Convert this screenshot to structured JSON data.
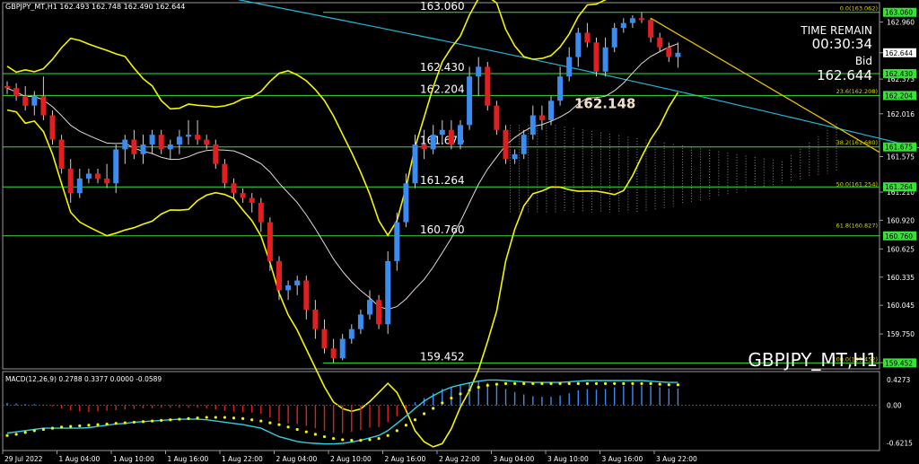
{
  "header": {
    "symbol_info": "GBPJPY_MT,H1  162.493 162.748 162.490 162.644",
    "time_remain_label": "TIME REMAIN",
    "time_remain_value": "00:30:34",
    "bid_label": "Bid",
    "bid_value": "162.644",
    "watermark": "GBPJPY_MT,H1",
    "macd_label": "MACD(12,26,9) 0.2788 0.3377 0.0000 -0.0589"
  },
  "colors": {
    "background": "#000000",
    "bull_candle": "#3a8cf0",
    "bear_candle": "#e02020",
    "bollinger": "#f5f500",
    "level_line": "#38e038",
    "macd_hist": "#3a8cf0",
    "macd_signal": "#f5f500",
    "macd_line": "#30d0e0",
    "trendline": "#e8c000",
    "ma_cyan": "#20b8d8"
  },
  "chart_data": {
    "type": "candlestick",
    "title": "GBPJPY_MT,H1",
    "ylim": [
      159.4,
      163.15
    ],
    "x_tick_labels": [
      "29 Jul 2022",
      "1 Aug 04:00",
      "1 Aug 10:00",
      "1 Aug 16:00",
      "1 Aug 22:00",
      "2 Aug 04:00",
      "2 Aug 10:00",
      "2 Aug 16:00",
      "2 Aug 22:00",
      "3 Aug 04:00",
      "3 Aug 10:00",
      "3 Aug 16:00",
      "3 Aug 22:00"
    ],
    "y_tick_labels": [
      "162.960",
      "162.644",
      "162.373",
      "162.016",
      "161.575",
      "161.210",
      "160.920",
      "160.625",
      "160.335",
      "160.045",
      "159.750",
      "159.455"
    ],
    "y_tick_values": [
      162.96,
      162.644,
      162.373,
      162.016,
      161.575,
      161.21,
      160.92,
      160.625,
      160.335,
      160.045,
      159.75,
      159.455
    ],
    "price_tags": [
      {
        "label": "163.060",
        "value": 163.06,
        "color": "#38e038"
      },
      {
        "label": "162.644",
        "value": 162.644,
        "color": "#ffffff"
      },
      {
        "label": "162.430",
        "value": 162.43,
        "color": "#38e038"
      },
      {
        "label": "162.204",
        "value": 162.204,
        "color": "#38e038"
      },
      {
        "label": "161.675",
        "value": 161.675,
        "color": "#38e038"
      },
      {
        "label": "161.264",
        "value": 161.264,
        "color": "#38e038"
      },
      {
        "label": "160.760",
        "value": 160.76,
        "color": "#38e038"
      },
      {
        "label": "159.452",
        "value": 159.452,
        "color": "#38e038"
      }
    ],
    "levels": [
      {
        "label": "163.060",
        "value": 163.06
      },
      {
        "label": "162.430",
        "value": 162.43
      },
      {
        "label": "162.204",
        "value": 162.204
      },
      {
        "label": "161.675",
        "value": 161.675
      },
      {
        "label": "161.264",
        "value": 161.264
      },
      {
        "label": "160.760",
        "value": 160.76
      },
      {
        "label": "159.452",
        "value": 159.452
      }
    ],
    "fib_levels": [
      {
        "label": "0.0(163.062)",
        "value": 163.062
      },
      {
        "label": "23.6(162.208)",
        "value": 162.208
      },
      {
        "label": "38.2(161.680)",
        "value": 161.68
      },
      {
        "label": "50.0(161.254)",
        "value": 161.254
      },
      {
        "label": "61.8(160.827)",
        "value": 160.827
      },
      {
        "label": "100.0(159.452)",
        "value": 159.452
      }
    ],
    "highlight_price": {
      "label": "162.148",
      "value": 162.148
    },
    "candles": [
      [
        162.3,
        162.35,
        162.22,
        162.28
      ],
      [
        162.28,
        162.33,
        162.15,
        162.2
      ],
      [
        162.2,
        162.3,
        162.05,
        162.1
      ],
      [
        162.1,
        162.25,
        162.0,
        162.2
      ],
      [
        162.2,
        162.4,
        161.95,
        162.0
      ],
      [
        162.0,
        162.05,
        161.7,
        161.75
      ],
      [
        161.75,
        161.8,
        161.4,
        161.45
      ],
      [
        161.45,
        161.55,
        161.1,
        161.2
      ],
      [
        161.2,
        161.45,
        161.15,
        161.35
      ],
      [
        161.35,
        161.45,
        161.3,
        161.4
      ],
      [
        161.4,
        161.45,
        161.3,
        161.35
      ],
      [
        161.35,
        161.5,
        161.25,
        161.3
      ],
      [
        161.3,
        161.7,
        161.2,
        161.65
      ],
      [
        161.65,
        161.8,
        161.5,
        161.75
      ],
      [
        161.75,
        161.85,
        161.55,
        161.6
      ],
      [
        161.6,
        161.8,
        161.5,
        161.7
      ],
      [
        161.7,
        161.85,
        161.6,
        161.8
      ],
      [
        161.8,
        161.85,
        161.6,
        161.65
      ],
      [
        161.65,
        161.75,
        161.55,
        161.7
      ],
      [
        161.7,
        161.85,
        161.6,
        161.78
      ],
      [
        161.78,
        161.95,
        161.7,
        161.8
      ],
      [
        161.8,
        161.95,
        161.7,
        161.75
      ],
      [
        161.75,
        161.8,
        161.65,
        161.7
      ],
      [
        161.7,
        161.75,
        161.45,
        161.5
      ],
      [
        161.5,
        161.55,
        161.25,
        161.3
      ],
      [
        161.3,
        161.35,
        161.15,
        161.2
      ],
      [
        161.2,
        161.25,
        161.1,
        161.15
      ],
      [
        161.15,
        161.2,
        161.0,
        161.1
      ],
      [
        161.1,
        161.15,
        160.8,
        160.9
      ],
      [
        160.9,
        160.95,
        160.4,
        160.5
      ],
      [
        160.5,
        160.55,
        160.1,
        160.2
      ],
      [
        160.2,
        160.3,
        160.1,
        160.25
      ],
      [
        160.25,
        160.35,
        160.15,
        160.3
      ],
      [
        160.3,
        160.35,
        159.9,
        160.0
      ],
      [
        160.0,
        160.1,
        159.7,
        159.8
      ],
      [
        159.8,
        159.9,
        159.55,
        159.6
      ],
      [
        159.6,
        159.7,
        159.45,
        159.5
      ],
      [
        159.5,
        159.75,
        159.48,
        159.7
      ],
      [
        159.7,
        159.85,
        159.65,
        159.8
      ],
      [
        159.8,
        160.0,
        159.75,
        159.95
      ],
      [
        159.95,
        160.2,
        159.9,
        160.1
      ],
      [
        160.1,
        160.15,
        159.8,
        159.85
      ],
      [
        159.85,
        160.6,
        159.75,
        160.5
      ],
      [
        160.5,
        161.0,
        160.4,
        160.9
      ],
      [
        160.9,
        161.4,
        160.85,
        161.3
      ],
      [
        161.3,
        161.8,
        161.25,
        161.7
      ],
      [
        161.7,
        161.85,
        161.55,
        161.65
      ],
      [
        161.65,
        161.9,
        161.6,
        161.8
      ],
      [
        161.8,
        161.95,
        161.7,
        161.85
      ],
      [
        161.85,
        161.95,
        161.65,
        161.7
      ],
      [
        161.7,
        161.95,
        161.65,
        161.9
      ],
      [
        161.9,
        162.5,
        161.85,
        162.4
      ],
      [
        162.4,
        162.6,
        162.2,
        162.5
      ],
      [
        162.5,
        162.55,
        162.05,
        162.1
      ],
      [
        162.1,
        162.15,
        161.8,
        161.85
      ],
      [
        161.85,
        161.9,
        161.5,
        161.55
      ],
      [
        161.55,
        161.65,
        161.5,
        161.6
      ],
      [
        161.6,
        161.85,
        161.55,
        161.8
      ],
      [
        161.8,
        162.1,
        161.75,
        162.0
      ],
      [
        162.0,
        162.1,
        161.85,
        161.95
      ],
      [
        161.95,
        162.2,
        161.9,
        162.15
      ],
      [
        162.15,
        162.5,
        162.1,
        162.4
      ],
      [
        162.4,
        162.7,
        162.35,
        162.6
      ],
      [
        162.6,
        162.9,
        162.5,
        162.85
      ],
      [
        162.85,
        162.95,
        162.7,
        162.75
      ],
      [
        162.75,
        162.8,
        162.4,
        162.45
      ],
      [
        162.45,
        162.8,
        162.4,
        162.7
      ],
      [
        162.7,
        162.95,
        162.65,
        162.9
      ],
      [
        162.9,
        163.0,
        162.85,
        162.95
      ],
      [
        162.95,
        163.03,
        162.9,
        163.0
      ],
      [
        163.0,
        163.06,
        162.95,
        162.98
      ],
      [
        162.98,
        163.0,
        162.75,
        162.8
      ],
      [
        162.8,
        162.85,
        162.65,
        162.7
      ],
      [
        162.7,
        162.75,
        162.55,
        162.6
      ],
      [
        162.6,
        162.75,
        162.49,
        162.644
      ]
    ],
    "macd": {
      "ylim": [
        -0.72,
        0.5
      ],
      "tick_labels": [
        "0.4273",
        "0.00",
        "-0.6215"
      ],
      "tick_values": [
        0.4273,
        0.0,
        -0.6215
      ],
      "histogram": [
        0.04,
        0.03,
        0.02,
        0.02,
        0.01,
        -0.02,
        -0.05,
        -0.08,
        -0.1,
        -0.11,
        -0.1,
        -0.09,
        -0.08,
        -0.07,
        -0.06,
        -0.05,
        -0.05,
        -0.04,
        -0.04,
        -0.04,
        -0.04,
        -0.04,
        -0.05,
        -0.07,
        -0.09,
        -0.1,
        -0.11,
        -0.12,
        -0.14,
        -0.2,
        -0.27,
        -0.3,
        -0.31,
        -0.34,
        -0.38,
        -0.42,
        -0.46,
        -0.46,
        -0.44,
        -0.41,
        -0.37,
        -0.36,
        -0.28,
        -0.18,
        -0.07,
        0.05,
        0.12,
        0.2,
        0.27,
        0.3,
        0.33,
        0.38,
        0.4,
        0.37,
        0.33,
        0.27,
        0.22,
        0.18,
        0.15,
        0.14,
        0.14,
        0.16,
        0.2,
        0.25,
        0.27,
        0.26,
        0.27,
        0.3,
        0.32,
        0.33,
        0.33,
        0.32,
        0.3,
        0.28,
        0.28
      ],
      "signal": [
        -0.5,
        -0.48,
        -0.45,
        -0.42,
        -0.4,
        -0.38,
        -0.36,
        -0.35,
        -0.34,
        -0.33,
        -0.32,
        -0.31,
        -0.3,
        -0.29,
        -0.28,
        -0.27,
        -0.26,
        -0.25,
        -0.24,
        -0.23,
        -0.22,
        -0.21,
        -0.2,
        -0.2,
        -0.2,
        -0.21,
        -0.22,
        -0.24,
        -0.26,
        -0.29,
        -0.32,
        -0.36,
        -0.4,
        -0.44,
        -0.48,
        -0.52,
        -0.55,
        -0.57,
        -0.58,
        -0.58,
        -0.57,
        -0.55,
        -0.5,
        -0.42,
        -0.33,
        -0.24,
        -0.14,
        -0.05,
        0.04,
        0.12,
        0.19,
        0.25,
        0.3,
        0.33,
        0.35,
        0.36,
        0.36,
        0.36,
        0.36,
        0.36,
        0.36,
        0.36,
        0.36,
        0.36,
        0.36,
        0.36,
        0.36,
        0.36,
        0.36,
        0.36,
        0.36,
        0.36,
        0.35,
        0.34,
        0.34
      ],
      "main": [
        -0.46,
        -0.44,
        -0.42,
        -0.4,
        -0.38,
        -0.38,
        -0.38,
        -0.38,
        -0.38,
        -0.37,
        -0.35,
        -0.33,
        -0.31,
        -0.3,
        -0.28,
        -0.27,
        -0.26,
        -0.25,
        -0.24,
        -0.23,
        -0.23,
        -0.23,
        -0.24,
        -0.26,
        -0.28,
        -0.3,
        -0.32,
        -0.35,
        -0.38,
        -0.45,
        -0.52,
        -0.56,
        -0.6,
        -0.62,
        -0.63,
        -0.64,
        -0.64,
        -0.63,
        -0.61,
        -0.58,
        -0.54,
        -0.5,
        -0.42,
        -0.3,
        -0.18,
        -0.05,
        0.07,
        0.16,
        0.24,
        0.3,
        0.34,
        0.37,
        0.4,
        0.42,
        0.42,
        0.41,
        0.4,
        0.39,
        0.38,
        0.38,
        0.38,
        0.38,
        0.39,
        0.4,
        0.41,
        0.41,
        0.41,
        0.41,
        0.41,
        0.41,
        0.41,
        0.4,
        0.39,
        0.38,
        0.38
      ]
    }
  }
}
